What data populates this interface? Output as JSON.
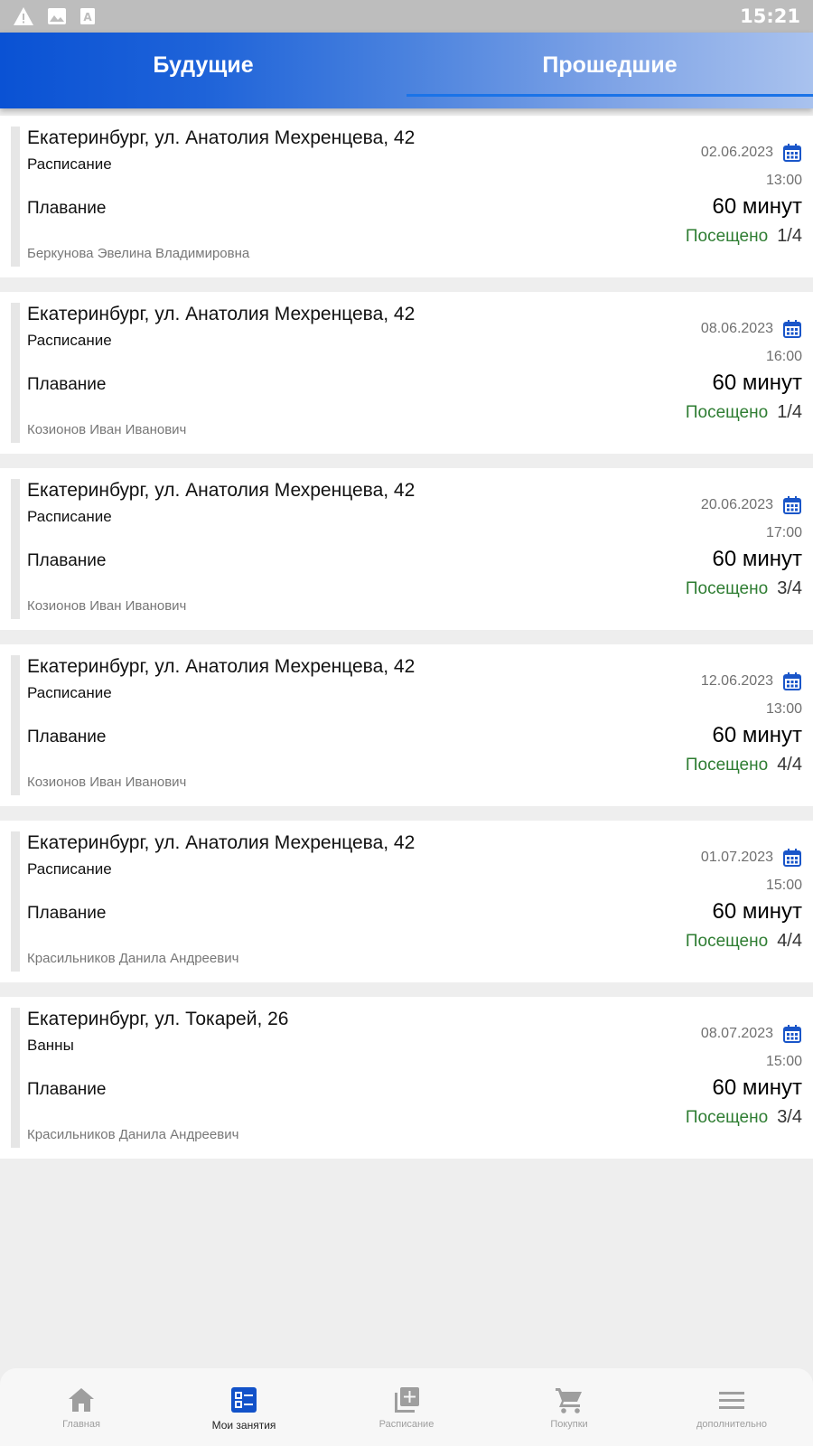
{
  "status_bar": {
    "time": "15:21",
    "icons": [
      "warning-icon",
      "image-icon",
      "text-a-icon"
    ]
  },
  "tabs": [
    {
      "label": "Будущие",
      "active": false
    },
    {
      "label": "Прошедшие",
      "active": true
    }
  ],
  "sessions": [
    {
      "address": "Екатеринбург, ул. Анатолия Мехренцева, 42",
      "category": "Расписание",
      "activity": "Плавание",
      "trainer": "Беркунова Эвелина Владимировна",
      "date": "02.06.2023",
      "time": "13:00",
      "duration": "60 минут",
      "status": "Посещено",
      "count": "1/4"
    },
    {
      "address": "Екатеринбург, ул. Анатолия Мехренцева, 42",
      "category": "Расписание",
      "activity": "Плавание",
      "trainer": "Козионов Иван Иванович",
      "date": "08.06.2023",
      "time": "16:00",
      "duration": "60 минут",
      "status": "Посещено",
      "count": "1/4"
    },
    {
      "address": "Екатеринбург, ул. Анатолия Мехренцева, 42",
      "category": "Расписание",
      "activity": "Плавание",
      "trainer": "Козионов Иван Иванович",
      "date": "20.06.2023",
      "time": "17:00",
      "duration": "60 минут",
      "status": "Посещено",
      "count": "3/4"
    },
    {
      "address": "Екатеринбург, ул. Анатолия Мехренцева, 42",
      "category": "Расписание",
      "activity": "Плавание",
      "trainer": "Козионов Иван Иванович",
      "date": "12.06.2023",
      "time": "13:00",
      "duration": "60 минут",
      "status": "Посещено",
      "count": "4/4"
    },
    {
      "address": "Екатеринбург, ул. Анатолия Мехренцева, 42",
      "category": "Расписание",
      "activity": "Плавание",
      "trainer": "Красильников Данила Андреевич",
      "date": "01.07.2023",
      "time": "15:00",
      "duration": "60 минут",
      "status": "Посещено",
      "count": "4/4"
    },
    {
      "address": "Екатеринбург, ул. Токарей, 26",
      "category": "Ванны",
      "activity": "Плавание",
      "trainer": "Красильников Данила Андреевич",
      "date": "08.07.2023",
      "time": "15:00",
      "duration": "60 минут",
      "status": "Посещено",
      "count": "3/4"
    }
  ],
  "bottom_nav": [
    {
      "label": "Главная",
      "icon": "home-icon",
      "active": false
    },
    {
      "label": "Мои занятия",
      "icon": "my-classes-icon",
      "active": true
    },
    {
      "label": "Расписание",
      "icon": "add-library-icon",
      "active": false
    },
    {
      "label": "Покупки",
      "icon": "cart-icon",
      "active": false
    },
    {
      "label": "дополнительно",
      "icon": "menu-icon",
      "active": false
    }
  ],
  "colors": {
    "accent": "#0a52d4",
    "visited": "#2e7d32",
    "calendar_icon": "#1a56c9"
  }
}
